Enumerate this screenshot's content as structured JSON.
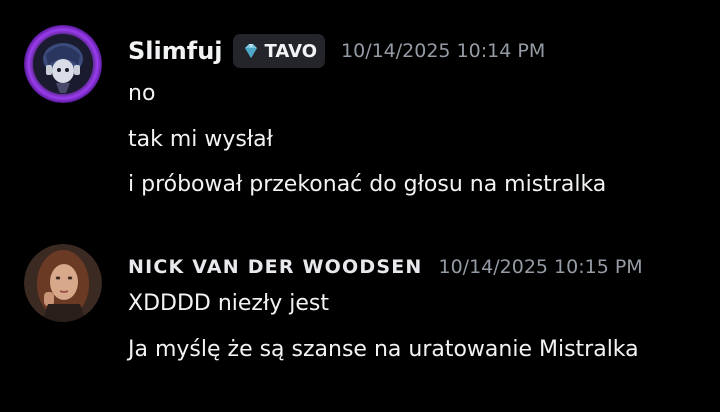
{
  "messages": [
    {
      "username": "Slimfuj",
      "tag": {
        "label": "TAVO",
        "icon": "gem-icon"
      },
      "timestamp": "10/14/2025 10:14 PM",
      "lines": [
        "no",
        "tak mi wysłał",
        "i próbował przekonać do głosu na mistralka"
      ]
    },
    {
      "username": "NICK VAN DER WOODSEN",
      "timestamp": "10/14/2025 10:15 PM",
      "lines": [
        "XDDDD niezły jest",
        "Ja myślę że są szanse na uratowanie Mistralka"
      ]
    }
  ],
  "colors": {
    "background": "#000000",
    "text": "#f2f3f5",
    "timestamp": "#949ba4",
    "tag_background": "#24252b",
    "avatar_glow": "#8a2be2"
  }
}
